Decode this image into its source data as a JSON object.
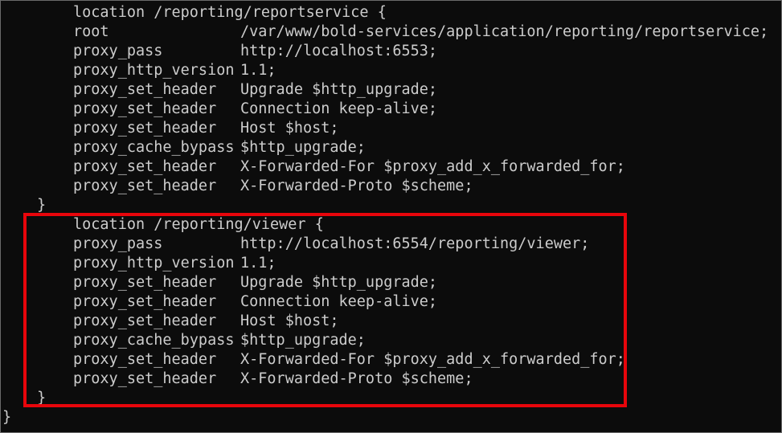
{
  "block1": {
    "opener": "location /reporting/reportservice {",
    "lines": [
      {
        "directive": "root",
        "value": "/var/www/bold-services/application/reporting/reportservice;"
      },
      {
        "directive": "proxy_pass",
        "value": "http://localhost:6553;"
      },
      {
        "directive": "proxy_http_version",
        "value": "1.1;"
      },
      {
        "directive": "proxy_set_header",
        "value": "Upgrade $http_upgrade;"
      },
      {
        "directive": "proxy_set_header",
        "value": "Connection keep-alive;"
      },
      {
        "directive": "proxy_set_header",
        "value": "Host $host;"
      },
      {
        "directive": "proxy_cache_bypass",
        "value": "$http_upgrade;"
      },
      {
        "directive": "proxy_set_header",
        "value": "X-Forwarded-For $proxy_add_x_forwarded_for;"
      },
      {
        "directive": "proxy_set_header",
        "value": "X-Forwarded-Proto $scheme;"
      }
    ],
    "closer": "}"
  },
  "block2": {
    "opener": "location /reporting/viewer {",
    "lines": [
      {
        "directive": "proxy_pass",
        "value": "http://localhost:6554/reporting/viewer;"
      },
      {
        "directive": "proxy_http_version",
        "value": "1.1;"
      },
      {
        "directive": "proxy_set_header",
        "value": "Upgrade $http_upgrade;"
      },
      {
        "directive": "proxy_set_header",
        "value": "Connection keep-alive;"
      },
      {
        "directive": "proxy_set_header",
        "value": "Host $host;"
      },
      {
        "directive": "proxy_cache_bypass",
        "value": "$http_upgrade;"
      },
      {
        "directive": "proxy_set_header",
        "value": "X-Forwarded-For $proxy_add_x_forwarded_for;"
      },
      {
        "directive": "proxy_set_header",
        "value": "X-Forwarded-Proto $scheme;"
      }
    ],
    "closer": "}"
  },
  "outer_closer": "}",
  "colors": {
    "background": "#0c0c0c",
    "text": "#cccccc",
    "highlight_border": "#e8050b"
  }
}
